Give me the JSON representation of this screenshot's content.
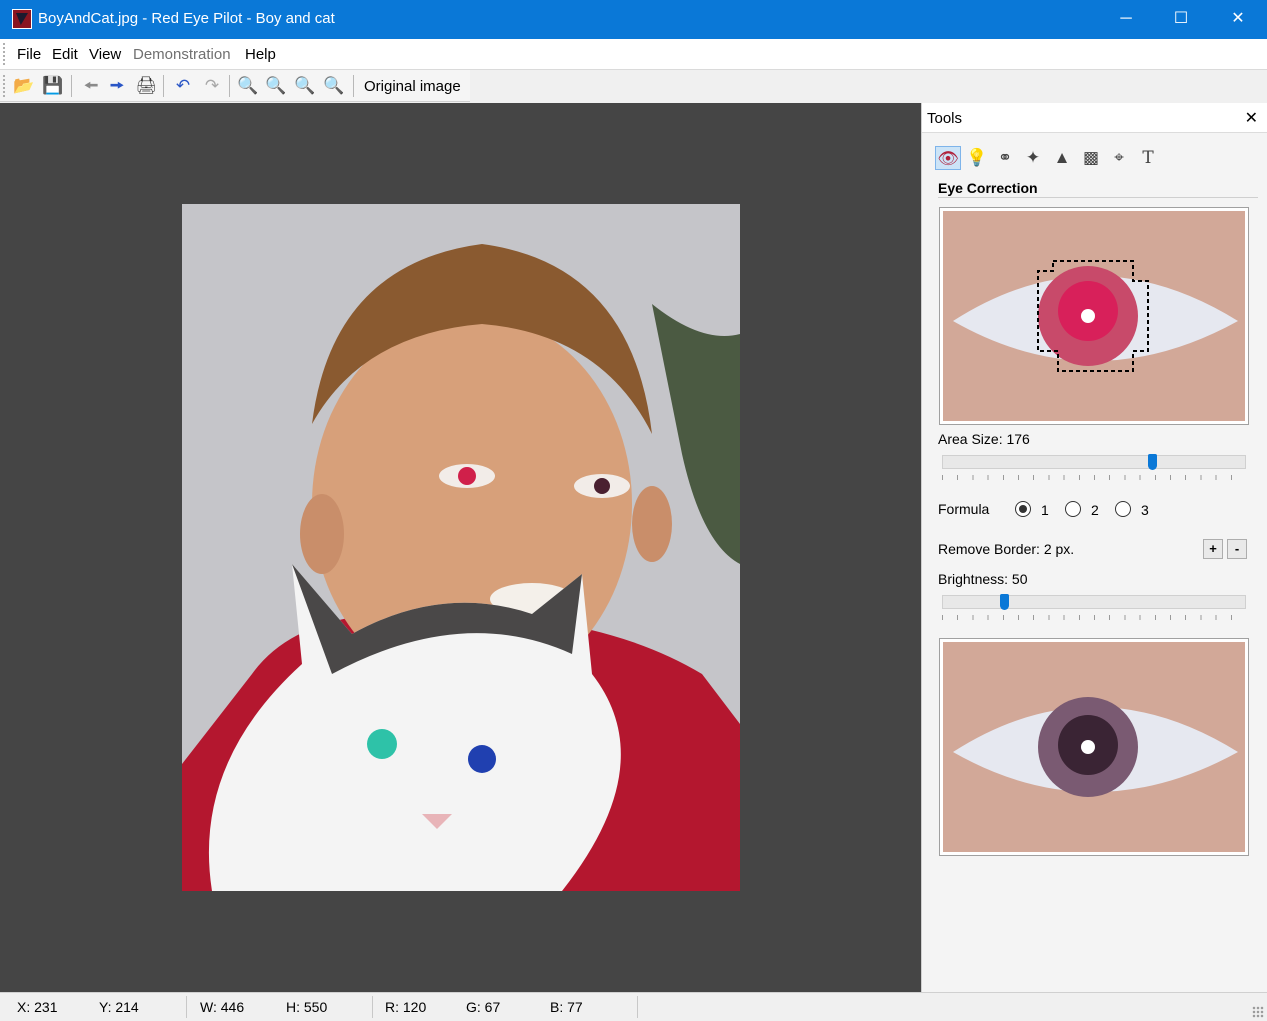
{
  "window": {
    "title": "BoyAndCat.jpg - Red Eye Pilot - Boy and cat",
    "minimize": "─",
    "maximize": "☐",
    "close": "✕"
  },
  "menu": {
    "file": "File",
    "edit": "Edit",
    "view": "View",
    "demonstration": "Demonstration",
    "help": "Help"
  },
  "toolbar": {
    "original_image": "Original image",
    "icons": [
      "open-folder-icon",
      "save-icon",
      "back-icon",
      "forward-icon",
      "print-icon",
      "undo-icon",
      "redo-icon",
      "zoom-in-icon",
      "zoom-out-icon",
      "zoom-fit-icon",
      "zoom-actual-icon"
    ]
  },
  "tools_panel": {
    "title": "Tools",
    "close": "✕",
    "section": "Eye Correction",
    "area_size_label": "Area Size: 176",
    "area_size_level": 0.69,
    "formula_label": "Formula",
    "formula_options": [
      "1",
      "2",
      "3"
    ],
    "formula_selected": "1",
    "remove_border_label": "Remove Border: 2 px.",
    "plus": "+",
    "minus": "-",
    "brightness_label": "Brightness: 50",
    "brightness_level": 0.2,
    "tool_icons": [
      "red-eye-icon",
      "light-bulb-icon",
      "color-wheel-icon",
      "magic-wand-icon",
      "shapes-icon",
      "fill-icon",
      "crop-icon",
      "text-icon"
    ]
  },
  "status": {
    "x": "X: 231",
    "y": "Y: 214",
    "w": "W: 446",
    "h": "H: 550",
    "r": "R: 120",
    "g": "G: 67",
    "b": "B: 77"
  },
  "colors": {
    "titlebar": "#0a78d7",
    "canvas": "#454545",
    "red_eye": "#d0204a",
    "slider": "#0a78d7"
  }
}
